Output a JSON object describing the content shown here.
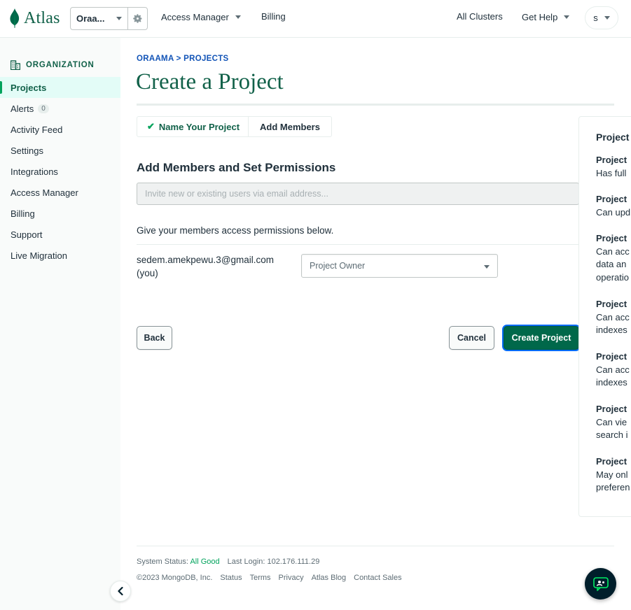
{
  "topbar": {
    "logo_text": "Atlas",
    "org_name": "Oraa...",
    "nav": [
      "Access Manager",
      "Billing"
    ],
    "right_nav": [
      "All Clusters",
      "Get Help"
    ],
    "user_initial": "s"
  },
  "sidebar": {
    "header": "ORGANIZATION",
    "items": [
      {
        "label": "Projects",
        "active": true
      },
      {
        "label": "Alerts",
        "badge": "0"
      },
      {
        "label": "Activity Feed"
      },
      {
        "label": "Settings"
      },
      {
        "label": "Integrations"
      },
      {
        "label": "Access Manager"
      },
      {
        "label": "Billing"
      },
      {
        "label": "Support"
      },
      {
        "label": "Live Migration"
      }
    ]
  },
  "main": {
    "breadcrumb_org": "ORAAMA",
    "breadcrumb_sep": " > ",
    "breadcrumb_section": "PROJECTS",
    "title": "Create a Project",
    "steps": [
      "Name Your Project",
      "Add Members"
    ],
    "section_title": "Add Members and Set Permissions",
    "invite_placeholder": "Invite new or existing users via email address...",
    "permissions_desc": "Give your members access permissions below.",
    "member_email": "sedem.amekpewu.3@gmail.com (you)",
    "member_role": "Project Owner",
    "back_label": "Back",
    "cancel_label": "Cancel",
    "create_label": "Create Project"
  },
  "roles_panel": {
    "title": "Project",
    "roles": [
      {
        "name": "Project",
        "desc": [
          "Has full"
        ]
      },
      {
        "name": "Project",
        "desc": [
          "Can upd"
        ]
      },
      {
        "name": "Project",
        "desc": [
          "Can acc",
          "data an",
          "operatio"
        ]
      },
      {
        "name": "Project",
        "desc": [
          "Can acc",
          "indexes"
        ]
      },
      {
        "name": "Project",
        "desc": [
          "Can acc",
          "indexes"
        ]
      },
      {
        "name": "Project",
        "desc": [
          "Can vie",
          "search i"
        ]
      },
      {
        "name": "Project",
        "desc": [
          "May onl",
          "preferen"
        ]
      }
    ]
  },
  "footer": {
    "status_label": "System Status:",
    "status_value": "All Good",
    "last_login": "Last Login: 102.176.111.29",
    "copyright": "©2023 MongoDB, Inc.",
    "links": [
      "Status",
      "Terms",
      "Privacy",
      "Atlas Blog",
      "Contact Sales"
    ]
  },
  "colors": {
    "brand_green": "#00684a",
    "dark_green": "#116149",
    "link_blue": "#016bf8",
    "success": "#00a35c"
  },
  "icons": [
    "mongodb-leaf-icon",
    "gear-icon",
    "building-icon",
    "check-icon",
    "chevron-left-icon",
    "chat-icon"
  ]
}
